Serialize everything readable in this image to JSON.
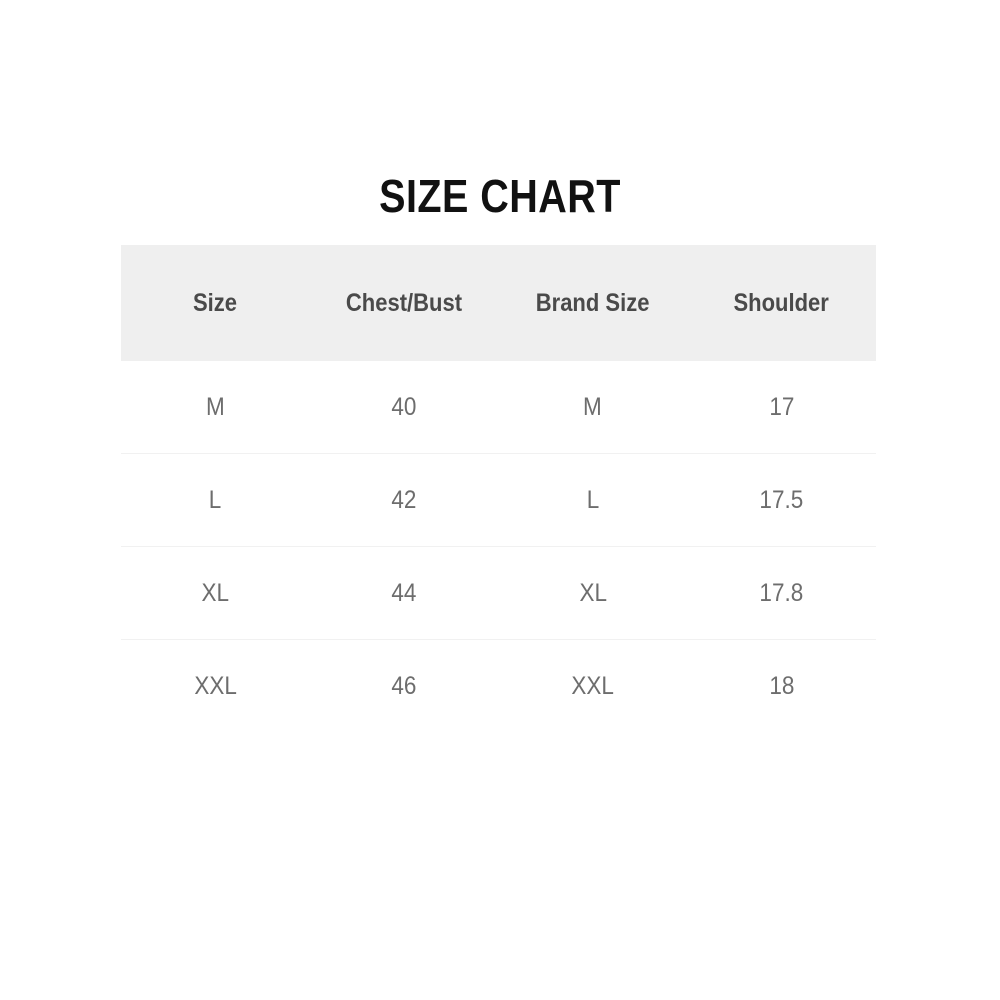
{
  "page": {
    "background_color": "#ffffff",
    "title": "SIZE CHART"
  },
  "table": {
    "header_background_color": "#efefef",
    "header_text_color": "#4a4a4a",
    "body_text_color": "#6d6d6d",
    "divider_color": "#f1f1f1",
    "columns": [
      {
        "key": "size",
        "label": "Size"
      },
      {
        "key": "chest_bust",
        "label": "Chest/Bust"
      },
      {
        "key": "brand_size",
        "label": "Brand Size"
      },
      {
        "key": "shoulder",
        "label": "Shoulder"
      }
    ],
    "rows": [
      {
        "size": "M",
        "chest_bust": "40",
        "brand_size": "M",
        "shoulder": "17"
      },
      {
        "size": "L",
        "chest_bust": "42",
        "brand_size": "L",
        "shoulder": "17.5"
      },
      {
        "size": "XL",
        "chest_bust": "44",
        "brand_size": "XL",
        "shoulder": "17.8"
      },
      {
        "size": "XXL",
        "chest_bust": "46",
        "brand_size": "XXL",
        "shoulder": "18"
      }
    ]
  },
  "chart_data": {
    "type": "table",
    "title": "SIZE CHART",
    "columns": [
      "Size",
      "Chest/Bust",
      "Brand Size",
      "Shoulder"
    ],
    "rows": [
      [
        "M",
        "40",
        "M",
        "17"
      ],
      [
        "L",
        "42",
        "L",
        "17.5"
      ],
      [
        "XL",
        "44",
        "XL",
        "17.8"
      ],
      [
        "XXL",
        "46",
        "XXL",
        "18"
      ]
    ],
    "series": [
      {
        "name": "Chest/Bust",
        "categories": [
          "M",
          "L",
          "XL",
          "XXL"
        ],
        "values": [
          40,
          42,
          44,
          46
        ]
      },
      {
        "name": "Shoulder",
        "categories": [
          "M",
          "L",
          "XL",
          "XXL"
        ],
        "values": [
          17,
          17.5,
          17.8,
          18
        ]
      }
    ],
    "xlabel": "Size",
    "ylabel": "",
    "legend": [
      "Chest/Bust",
      "Shoulder"
    ]
  }
}
